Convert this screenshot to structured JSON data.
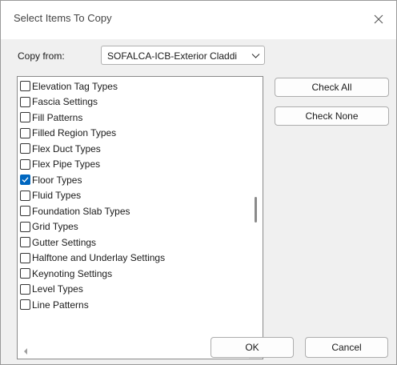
{
  "dialog": {
    "title": "Select Items To Copy",
    "copy_from_label": "Copy from:",
    "copy_from_value": "SOFALCA-ICB-Exterior Claddi",
    "items": [
      {
        "label": "Elevation Tag Types",
        "checked": false
      },
      {
        "label": "Fascia Settings",
        "checked": false
      },
      {
        "label": "Fill Patterns",
        "checked": false
      },
      {
        "label": "Filled Region Types",
        "checked": false
      },
      {
        "label": "Flex Duct Types",
        "checked": false
      },
      {
        "label": "Flex Pipe Types",
        "checked": false
      },
      {
        "label": "Floor Types",
        "checked": true
      },
      {
        "label": "Fluid Types",
        "checked": false
      },
      {
        "label": "Foundation Slab Types",
        "checked": false
      },
      {
        "label": "Grid Types",
        "checked": false
      },
      {
        "label": "Gutter Settings",
        "checked": false
      },
      {
        "label": "Halftone and Underlay Settings",
        "checked": false
      },
      {
        "label": "Keynoting Settings",
        "checked": false
      },
      {
        "label": "Level Types",
        "checked": false
      },
      {
        "label": "Line Patterns",
        "checked": false
      }
    ],
    "check_all_label": "Check All",
    "check_none_label": "Check None",
    "ok_label": "OK",
    "cancel_label": "Cancel"
  },
  "icons": {
    "close": "close-icon",
    "dropdown": "chevron-down-icon",
    "checked": "checkmark-icon"
  },
  "colors": {
    "accent": "#0067c0"
  }
}
